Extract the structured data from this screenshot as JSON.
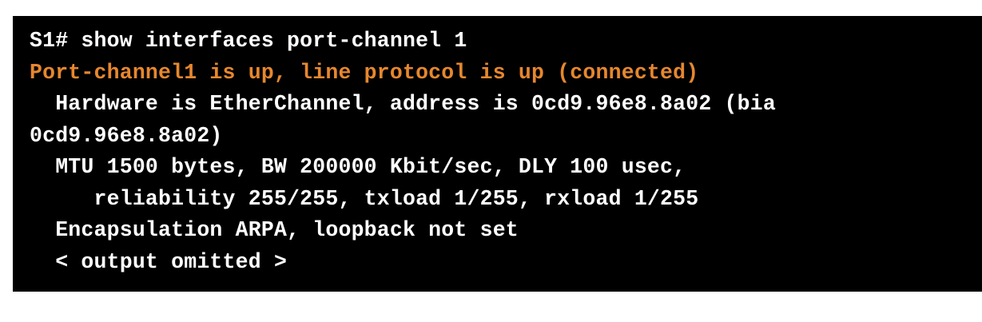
{
  "terminal": {
    "text_color": "#ffffff",
    "highlight_color": "#e6872e",
    "background_color": "#000000",
    "lines": [
      {
        "text": "S1# show interfaces port-channel 1",
        "highlight": false
      },
      {
        "text": "Port-channel1 is up, line protocol is up (connected)",
        "highlight": true
      },
      {
        "text": "  Hardware is EtherChannel, address is 0cd9.96e8.8a02 (bia",
        "highlight": false
      },
      {
        "text": "0cd9.96e8.8a02)",
        "highlight": false
      },
      {
        "text": "  MTU 1500 bytes, BW 200000 Kbit/sec, DLY 100 usec,",
        "highlight": false
      },
      {
        "text": "     reliability 255/255, txload 1/255, rxload 1/255",
        "highlight": false
      },
      {
        "text": "  Encapsulation ARPA, loopback not set",
        "highlight": false
      },
      {
        "text": "  < output omitted >",
        "highlight": false
      }
    ]
  }
}
